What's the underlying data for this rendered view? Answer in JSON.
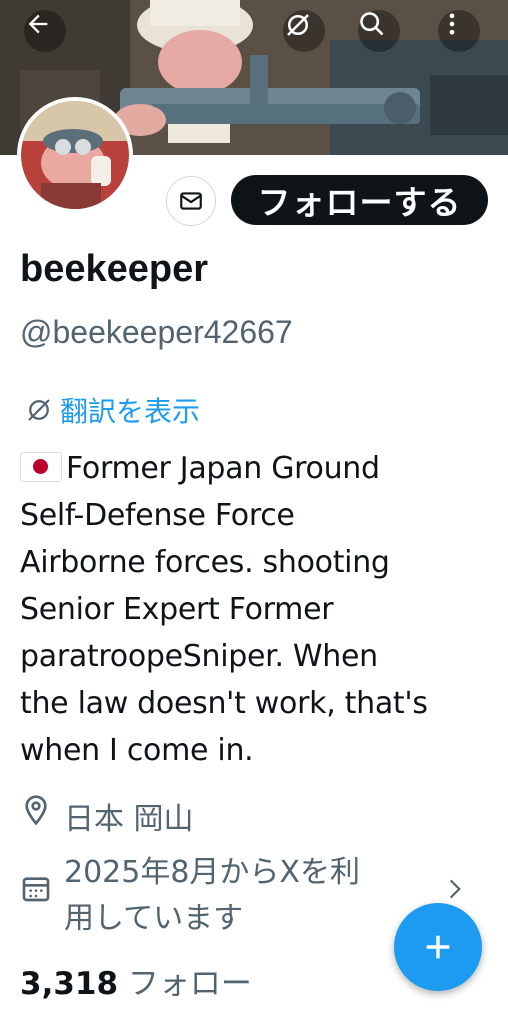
{
  "profile": {
    "display_name": "beekeeper",
    "handle": "@beekeeper42667",
    "follow_label": "フォローする",
    "translate_label": "翻訳を表示",
    "bio_line1": "Former Japan Ground",
    "bio_line2": "Self-Defense Force",
    "bio_line3": "Airborne forces. shooting",
    "bio_line4": "Senior Expert Former",
    "bio_line5": "paratroopeSniper. When",
    "bio_line6": "the law doesn't work, that's",
    "bio_line7": "when I come in.",
    "location": "日本 岡山",
    "joined_line1": "2025年8月からXを利",
    "joined_line2": "用しています",
    "following_count": "3,318",
    "following_label": "フォロー"
  },
  "icons": {
    "back": "back-arrow-icon",
    "grok": "grok-icon",
    "search": "search-icon",
    "more": "more-vertical-icon",
    "dm": "mail-icon",
    "location": "location-pin-icon",
    "calendar": "calendar-icon",
    "compose": "plus-icon"
  },
  "colors": {
    "accent": "#1d9bf0",
    "text": "#0f1419",
    "secondary": "#536471"
  }
}
